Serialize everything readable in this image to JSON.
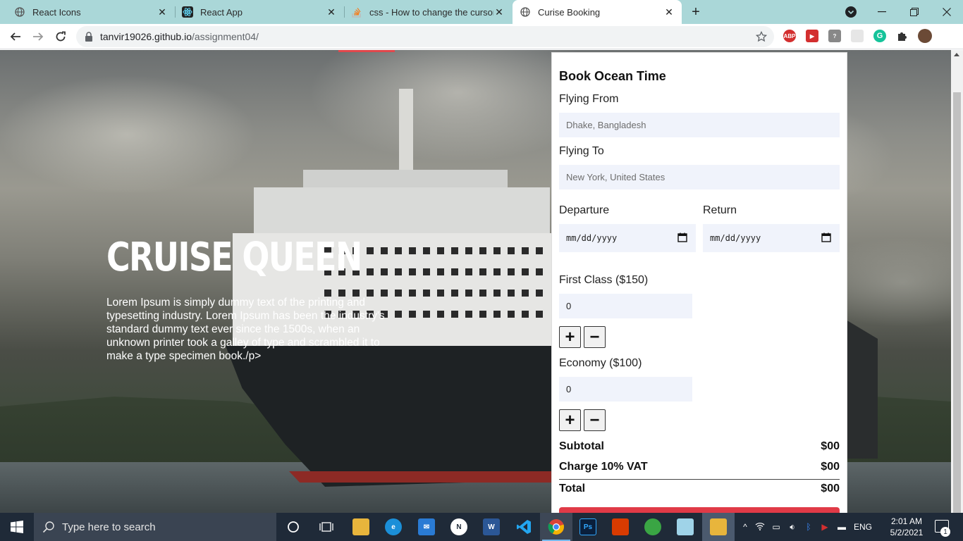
{
  "browser": {
    "tabs": [
      {
        "title": "React Icons",
        "icon": "globe-icon",
        "active": false
      },
      {
        "title": "React App",
        "icon": "react-icon",
        "active": false
      },
      {
        "title": "css - How to change the cursor ir",
        "icon": "stackoverflow-icon",
        "active": false
      },
      {
        "title": "Curise Booking",
        "icon": "globe-icon",
        "active": true
      }
    ],
    "url_host": "tanvir19026.github.io",
    "url_path": "/assignment04/"
  },
  "hero": {
    "title": "CRUISE QUEEN",
    "text": "Lorem Ipsum is simply dummy text of the printing and typesetting industry. Lorem Ipsum has been the industry's standard dummy text ever since the 1500s, when an unknown printer took a galley of type and scrambled it to make a type specimen book./p>"
  },
  "booking": {
    "title": "Book Ocean Time",
    "from_label": "Flying From",
    "from_placeholder": "Dhake, Bangladesh",
    "to_label": "Flying To",
    "to_placeholder": "New York, United States",
    "departure_label": "Departure",
    "return_label": "Return",
    "date_placeholder": "mm/dd/yyyy",
    "first_class_label": "First Class ($150)",
    "first_class_qty": "0",
    "economy_label": "Economy ($100)",
    "economy_qty": "0",
    "plus": "+",
    "minus": "−",
    "subtotal_label": "Subtotal",
    "subtotal_value": "$00",
    "vat_label": "Charge 10% VAT",
    "vat_value": "$00",
    "total_label": "Total",
    "total_value": "$00"
  },
  "taskbar": {
    "search_placeholder": "Type here to search",
    "language": "ENG",
    "time": "2:01 AM",
    "date": "5/2/2021",
    "notification_count": "1"
  },
  "colors": {
    "tabbar": "#aad7d8",
    "accent_red": "#e03a47",
    "input_bg": "#f0f3fb",
    "taskbar": "#1f2a38"
  }
}
